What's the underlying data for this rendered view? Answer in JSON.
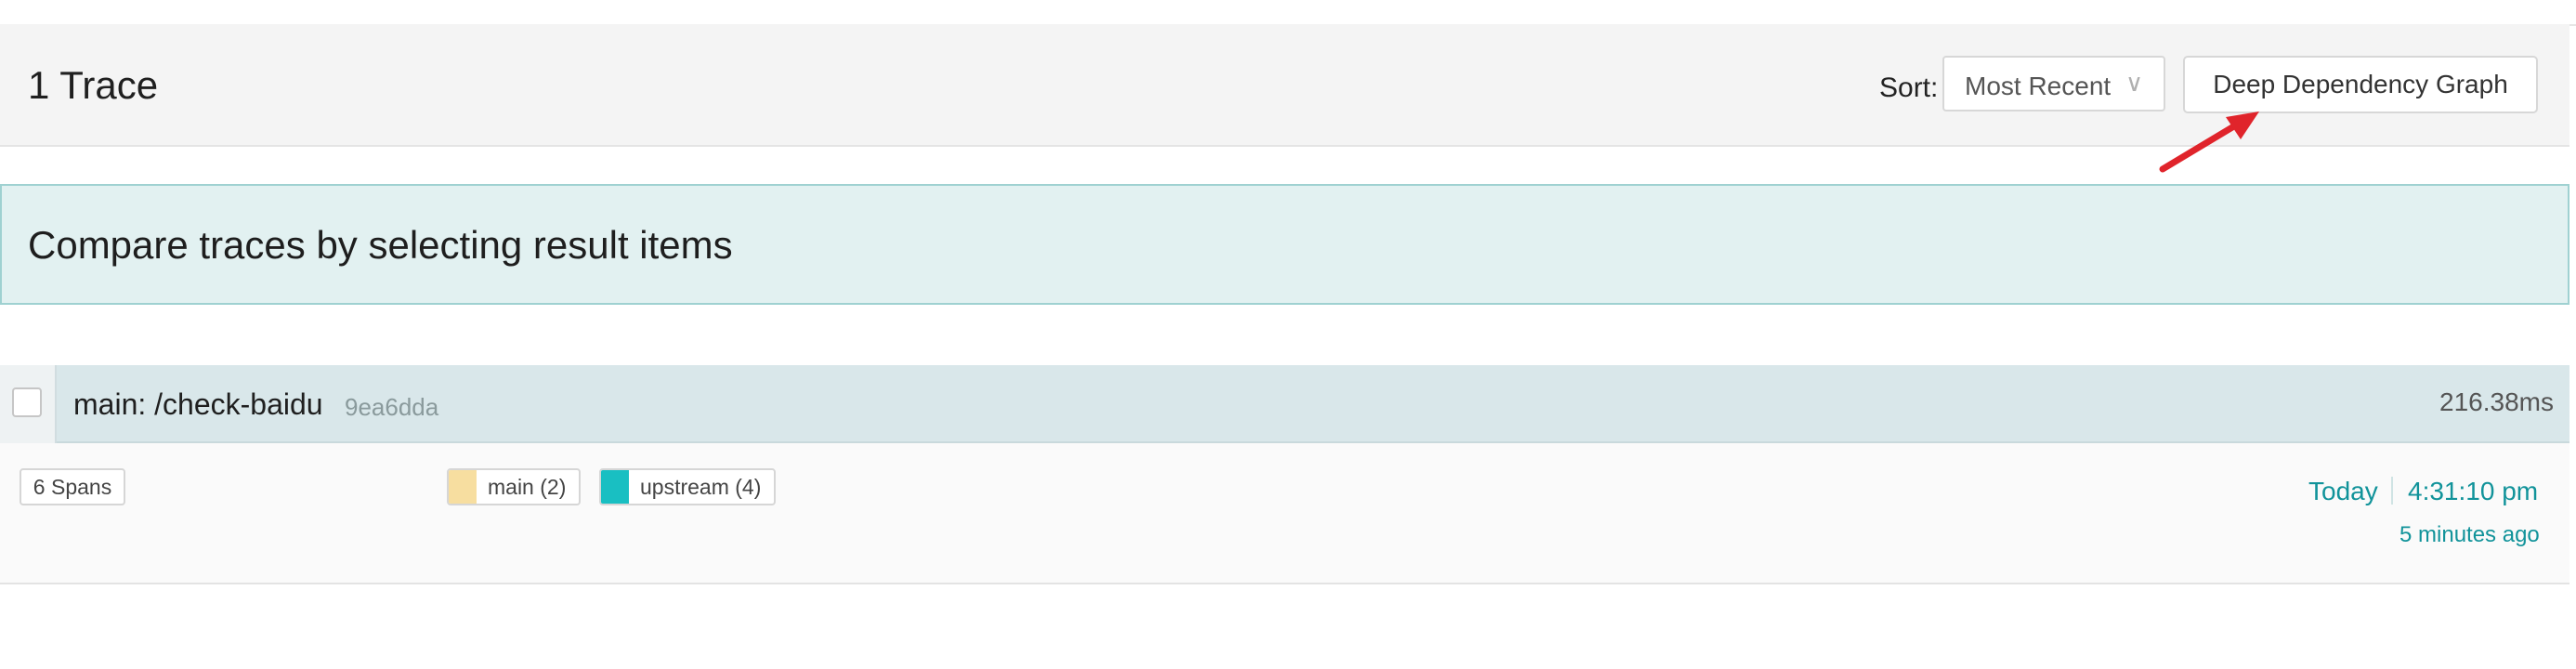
{
  "header": {
    "trace_count": "1 Trace",
    "sort_label": "Sort:",
    "sort_value": "Most Recent",
    "deep_graph_label": "Deep Dependency Graph"
  },
  "compare_banner": {
    "text": "Compare traces by selecting result items"
  },
  "result": {
    "name": "main: /check-baidu",
    "trace_id": "9ea6dda",
    "duration": "216.38ms",
    "spans": "6 Spans",
    "services": [
      {
        "label": "main (2)",
        "color": "#f7dea0"
      },
      {
        "label": "upstream (4)",
        "color": "#19bfc2"
      }
    ],
    "date": "Today",
    "time": "4:31:10 pm",
    "ago": "5 minutes ago"
  },
  "annotation": {
    "arrow_color": "#e0242b"
  },
  "icons": {
    "sort_dropdown": "chevron-down-icon"
  }
}
